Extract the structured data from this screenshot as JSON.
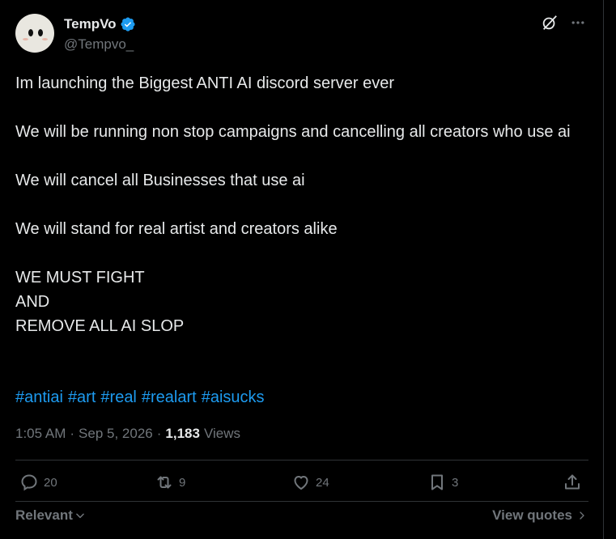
{
  "colors": {
    "background": "#000000",
    "text": "#e7e9ea",
    "muted": "#71767b",
    "accent": "#1d9bf0",
    "border": "#2f3336"
  },
  "author": {
    "display_name": "TempVo",
    "handle": "@Tempvo_",
    "verified_icon": "verified-badge-icon"
  },
  "post": {
    "lines": [
      "Im launching the Biggest ANTI AI discord server ever",
      "We will be running non stop campaigns and cancelling all creators who use ai",
      "We will cancel all Businesses that use ai",
      "We will stand for real artist and creators alike",
      "WE MUST FIGHT",
      "AND",
      "REMOVE ALL AI SLOP"
    ],
    "hashtags": [
      "#antiai",
      "#art",
      "#real",
      "#realart",
      "#aisucks"
    ]
  },
  "meta": {
    "time": "1:05 AM",
    "separator": "·",
    "date": "Sep 5, 2026",
    "views_count": "1,183",
    "views_label": "Views"
  },
  "actions": {
    "replies": "20",
    "reposts": "9",
    "likes": "24",
    "bookmarks": "3"
  },
  "bottom": {
    "sort_label": "Relevant",
    "view_quotes_label": "View quotes"
  },
  "icons": [
    "grok-icon",
    "more-icon",
    "reply-icon",
    "repost-icon",
    "like-icon",
    "bookmark-icon",
    "share-icon",
    "chevron-down-icon",
    "chevron-right-icon"
  ]
}
